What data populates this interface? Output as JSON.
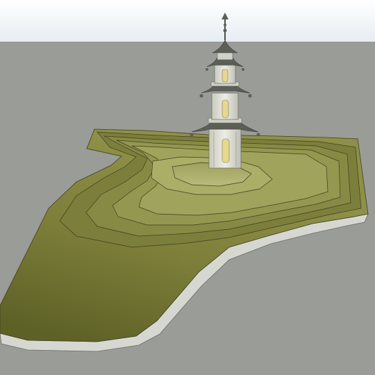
{
  "scene": {
    "sky_color_top": "#ffffff",
    "sky_color_bottom": "#e6edf3",
    "ground_color": "#9a9c98",
    "terrain_color_dark": "#67692b",
    "terrain_color_light": "#b7b978",
    "terrain_edge_color": "#d7d7d2",
    "pagoda_wall_color": "#d8d9cf",
    "pagoda_roof_color": "#5c5f58",
    "pagoda_window_color": "#e6d88c"
  }
}
